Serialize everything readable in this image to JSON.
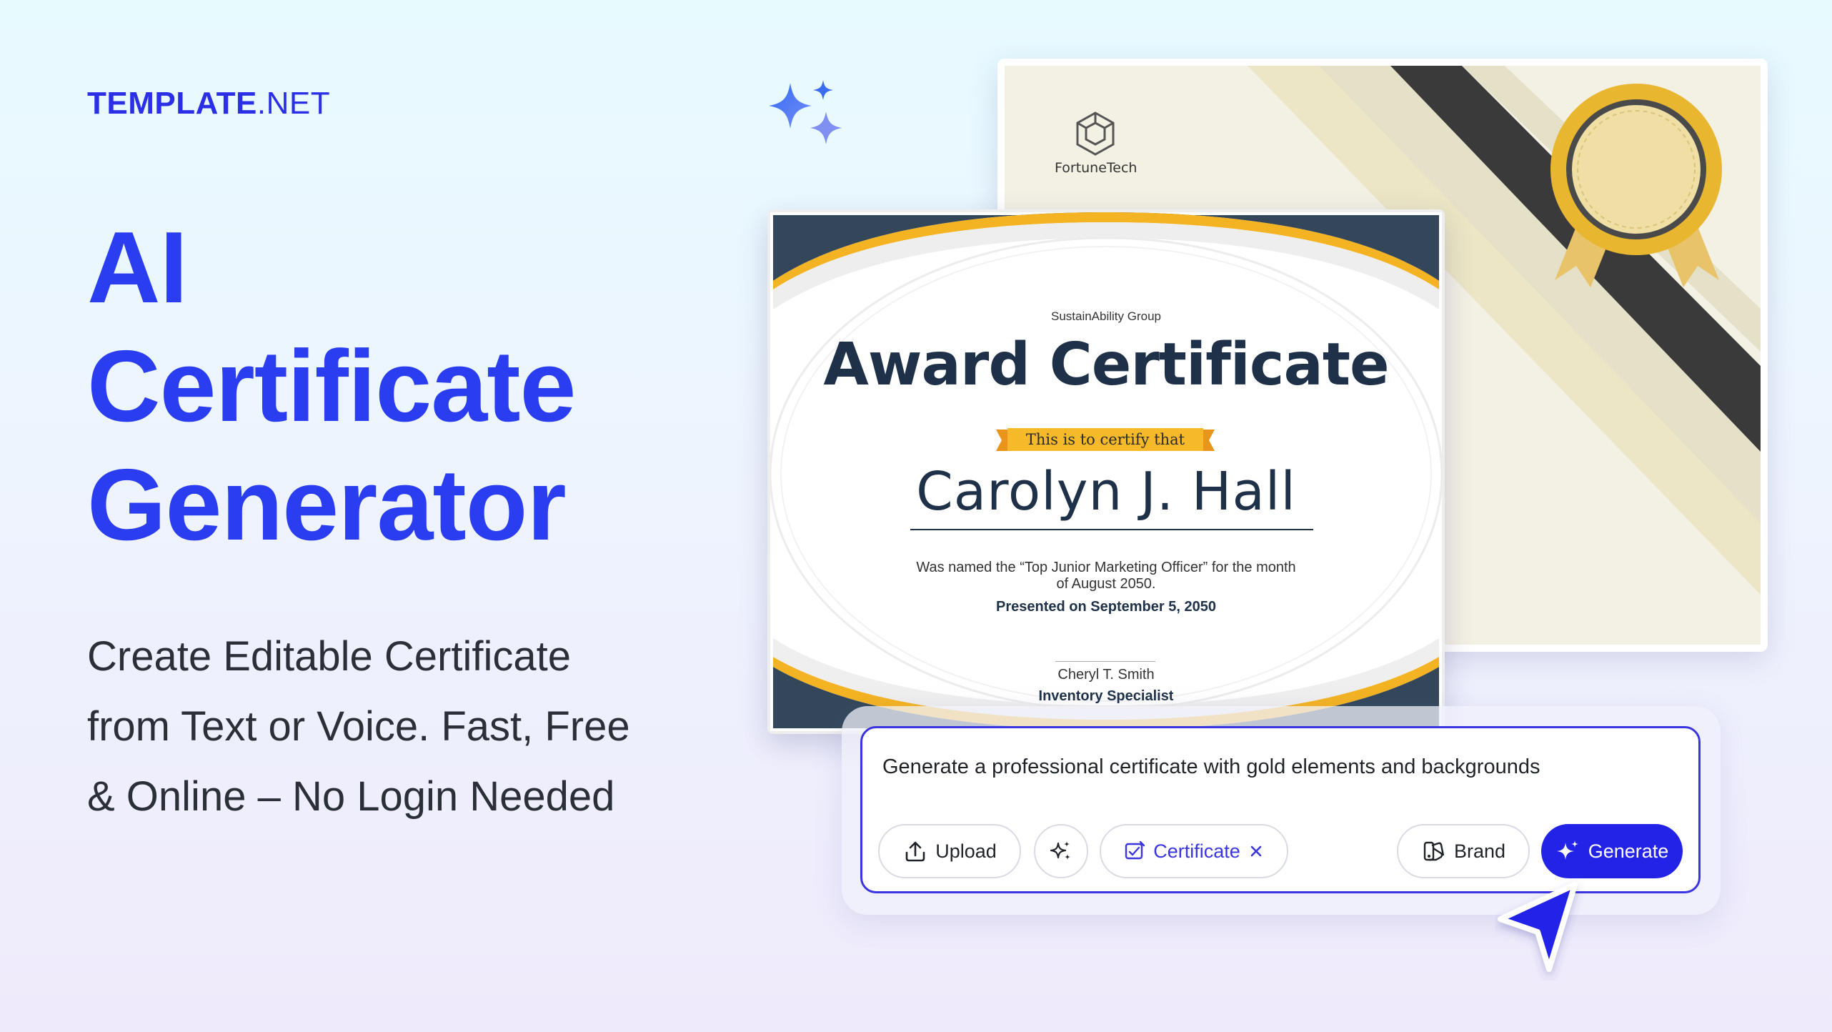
{
  "brand": {
    "bold": "TEMPLATE",
    "rest": ".NET"
  },
  "headline": {
    "line1": "AI",
    "line2": "Certificate",
    "line3": "Generator"
  },
  "subtitle": {
    "line1": "Create Editable Certificate",
    "line2": "from Text or Voice. Fast, Free",
    "line3": "& Online – No Login Needed"
  },
  "back_certificate": {
    "company": "FortuneTech"
  },
  "certificate": {
    "organization": "SustainAbility Group",
    "title": "Award Certificate",
    "ribbon": "This is to certify that",
    "recipient": "Carolyn J. Hall",
    "description_line1": "Was named the “Top Junior Marketing Officer” for the month",
    "description_line2": "of August 2050.",
    "presented": "Presented on September 5, 2050",
    "signer_name": "Cheryl T. Smith",
    "signer_title": "Inventory Specialist"
  },
  "prompt": {
    "text": "Generate a professional certificate with gold elements and backgrounds",
    "upload_label": "Upload",
    "chip_label": "Certificate",
    "brand_label": "Brand",
    "generate_label": "Generate"
  },
  "colors": {
    "accent": "#2a3df0",
    "generate_button": "#2323e8",
    "certificate_navy": "#1e3148",
    "gold": "#f4b322"
  },
  "icons": [
    "sparkles-icon",
    "fortunetech-logo-icon",
    "upload-icon",
    "magic-wand-icon",
    "certificate-icon",
    "close-icon",
    "brand-icon",
    "sparkle-icon",
    "cursor-arrow-icon"
  ]
}
